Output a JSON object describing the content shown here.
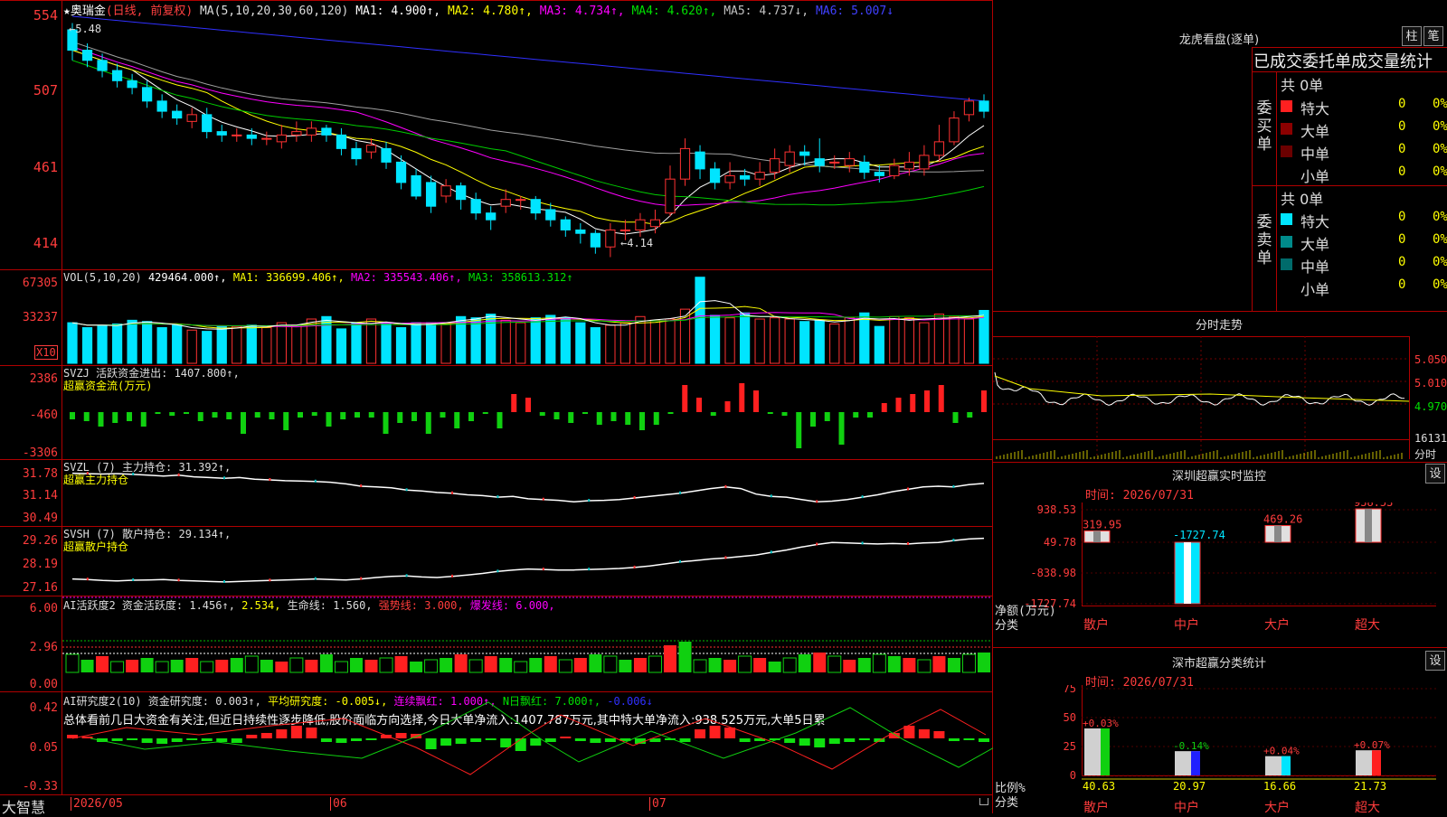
{
  "colors": {
    "up": "#ff3232",
    "down": "#00e5ff",
    "ma1": "#ffffff",
    "ma2": "#ffff00",
    "ma3": "#ff00ff",
    "ma4": "#00cc00",
    "ma5": "#a0a0a0",
    "ma6": "#3030ff",
    "frame": "#b00000",
    "label": "#ff3c3c"
  },
  "header": {
    "star": "★",
    "name": "奥瑞金",
    "period": "(日线, 前复权)",
    "ma_def": "MA(5,10,20,30,60,120)",
    "ma1": "MA1: 4.900↑,",
    "ma2": "MA2: 4.780↑,",
    "ma3": "MA3: 4.734↑,",
    "ma4": "MA4: 4.620↑,",
    "ma5": "MA5: 4.737↓,",
    "ma6": "MA6: 5.007↓"
  },
  "price_axis": [
    "554",
    "507",
    "461",
    "414"
  ],
  "annotations": {
    "high": "←5.48",
    "low": "←4.14"
  },
  "vol": {
    "title": "VOL(5,10,20)",
    "value": "429464.000↑,",
    "ma1": "MA1: 336699.406↑,",
    "ma2": "MA2: 335543.406↑,",
    "ma3": "MA3: 358613.312↑",
    "axis": [
      "67305",
      "33237"
    ],
    "unit": "X10"
  },
  "svzj": {
    "title": "SVZJ  活跃资金进出: 1407.800↑,",
    "sub": "超赢资金流(万元)",
    "axis": [
      "2386",
      "-460",
      "-3306"
    ]
  },
  "svzl": {
    "title": "SVZL (7) 主力持仓: 31.392↑,",
    "sub": "超赢主力持仓",
    "axis": [
      "31.78",
      "31.14",
      "30.49"
    ]
  },
  "svsh": {
    "title": "SVSH (7) 散户持仓: 29.134↑,",
    "sub": "超赢散户持仓",
    "axis": [
      "29.26",
      "28.19",
      "27.16"
    ]
  },
  "ai_act": {
    "t1": "AI活跃度2 资金活跃度: 1.456↑,",
    "t2": "2.534,",
    "t3": "生命线: 1.560,",
    "t4": "强势线: 3.000,",
    "t5": "爆发线: 6.000,",
    "axis": [
      "6.00",
      "2.96",
      "0.00"
    ]
  },
  "ai_res": {
    "t1": "AI研究度2(10) 资金研究度: 0.003↑,",
    "t2": "平均研究度: -0.005↓,",
    "t3": "连续飘红: 1.000↑,",
    "t4": "N日飘红: 7.000↑,",
    "t5": "-0.006↓",
    "summary": "总体看前几日大资金有关注,但近日持续性逐步降低,股价面临方向选择,今日大单净流入:1407.787万元,其中特大单净流入:938.525万元,大单5日累",
    "axis": [
      "0.42",
      "0.05",
      "-0.33"
    ]
  },
  "date_axis": {
    "brand": "大智慧",
    "d1": "2026/05",
    "d2": "06",
    "d3": "07"
  },
  "longhu": {
    "title": "龙虎看盘(逐单)",
    "btn1": "柱",
    "btn2": "笔",
    "tabs": "已成交委托单成交量统计",
    "buy": {
      "side": "委买单",
      "total": "共 0单",
      "rows": [
        {
          "name": "特大",
          "v": "0",
          "p": "0%"
        },
        {
          "name": "大单",
          "v": "0",
          "p": "0%"
        },
        {
          "name": "中单",
          "v": "0",
          "p": "0%"
        },
        {
          "name": "小单",
          "v": "0",
          "p": "0%"
        }
      ]
    },
    "sell": {
      "side": "委卖单",
      "total": "共 0单",
      "rows": [
        {
          "name": "特大",
          "v": "0",
          "p": "0%"
        },
        {
          "name": "大单",
          "v": "0",
          "p": "0%"
        },
        {
          "name": "中单",
          "v": "0",
          "p": "0%"
        },
        {
          "name": "小单",
          "v": "0",
          "p": "0%"
        }
      ]
    }
  },
  "intraday": {
    "title": "分时走势",
    "axis": [
      "5.050",
      "5.010",
      "4.970",
      "16131"
    ],
    "unit": "分时"
  },
  "sz_monitor": {
    "title": "深圳超赢实时监控",
    "btn": "设",
    "time": "时间: 2026/07/31",
    "axis": [
      "938.53",
      "49.78",
      "-838.98",
      "-1727.74"
    ],
    "ylabel": "净额(万元)",
    "xlabel": "分类",
    "bars": [
      {
        "cat": "散户",
        "val": "319.95"
      },
      {
        "cat": "中户",
        "val": "-1727.74"
      },
      {
        "cat": "大户",
        "val": "469.26"
      },
      {
        "cat": "超大",
        "val": "938.53"
      }
    ]
  },
  "sz_class": {
    "title": "深市超赢分类统计",
    "btn": "设",
    "time": "时间: 2026/07/31",
    "axis": [
      "75",
      "50",
      "25",
      "0"
    ],
    "ylabel": "比例%",
    "xlabel": "分类",
    "bars": [
      {
        "cat": "散户",
        "val": "40.63",
        "chg": "+0.03%"
      },
      {
        "cat": "中户",
        "val": "20.97",
        "chg": "-0.14%"
      },
      {
        "cat": "大户",
        "val": "16.66",
        "chg": "+0.04%"
      },
      {
        "cat": "超大",
        "val": "21.73",
        "chg": "+0.07%"
      }
    ]
  },
  "chart_data": {
    "type": "candlestick",
    "ylim": [
      414,
      554
    ],
    "candles": [
      [
        5.48,
        5.36,
        5.52,
        5.3
      ],
      [
        5.36,
        5.3,
        5.4,
        5.26
      ],
      [
        5.3,
        5.24,
        5.34,
        5.2
      ],
      [
        5.24,
        5.18,
        5.28,
        5.14
      ],
      [
        5.18,
        5.14,
        5.22,
        5.1
      ],
      [
        5.14,
        5.06,
        5.18,
        5.02
      ],
      [
        5.06,
        5.0,
        5.1,
        4.96
      ],
      [
        5.0,
        4.96,
        5.04,
        4.92
      ],
      [
        4.94,
        4.98,
        5.02,
        4.9
      ],
      [
        4.98,
        4.88,
        5.02,
        4.84
      ],
      [
        4.88,
        4.86,
        4.92,
        4.82
      ],
      [
        4.86,
        4.86,
        4.9,
        4.82
      ],
      [
        4.86,
        4.84,
        4.9,
        4.8
      ],
      [
        4.84,
        4.84,
        4.88,
        4.8
      ],
      [
        4.82,
        4.86,
        4.92,
        4.78
      ],
      [
        4.86,
        4.88,
        4.94,
        4.82
      ],
      [
        4.86,
        4.9,
        4.94,
        4.82
      ],
      [
        4.9,
        4.86,
        4.92,
        4.82
      ],
      [
        4.86,
        4.78,
        4.9,
        4.74
      ],
      [
        4.78,
        4.72,
        4.82,
        4.68
      ],
      [
        4.76,
        4.8,
        4.84,
        4.72
      ],
      [
        4.78,
        4.7,
        4.82,
        4.66
      ],
      [
        4.7,
        4.58,
        4.74,
        4.54
      ],
      [
        4.62,
        4.5,
        4.66,
        4.48
      ],
      [
        4.58,
        4.44,
        4.62,
        4.4
      ],
      [
        4.5,
        4.56,
        4.6,
        4.46
      ],
      [
        4.56,
        4.48,
        4.58,
        4.42
      ],
      [
        4.48,
        4.4,
        4.52,
        4.36
      ],
      [
        4.4,
        4.36,
        4.44,
        4.3
      ],
      [
        4.44,
        4.48,
        4.54,
        4.4
      ],
      [
        4.48,
        4.48,
        4.5,
        4.42
      ],
      [
        4.48,
        4.4,
        4.5,
        4.36
      ],
      [
        4.42,
        4.36,
        4.46,
        4.32
      ],
      [
        4.36,
        4.3,
        4.38,
        4.26
      ],
      [
        4.3,
        4.28,
        4.34,
        4.22
      ],
      [
        4.28,
        4.2,
        4.3,
        4.16
      ],
      [
        4.2,
        4.3,
        4.34,
        4.14
      ],
      [
        4.3,
        4.3,
        4.36,
        4.24
      ],
      [
        4.3,
        4.36,
        4.4,
        4.26
      ],
      [
        4.32,
        4.36,
        4.42,
        4.28
      ],
      [
        4.4,
        4.6,
        4.68,
        4.38
      ],
      [
        4.6,
        4.78,
        4.84,
        4.56
      ],
      [
        4.76,
        4.66,
        4.8,
        4.6
      ],
      [
        4.66,
        4.58,
        4.7,
        4.54
      ],
      [
        4.58,
        4.62,
        4.7,
        4.54
      ],
      [
        4.62,
        4.6,
        4.66,
        4.56
      ],
      [
        4.6,
        4.64,
        4.7,
        4.56
      ],
      [
        4.64,
        4.72,
        4.78,
        4.6
      ],
      [
        4.68,
        4.76,
        4.8,
        4.64
      ],
      [
        4.76,
        4.74,
        4.8,
        4.68
      ],
      [
        4.72,
        4.68,
        4.84,
        4.64
      ],
      [
        4.7,
        4.7,
        4.74,
        4.66
      ],
      [
        4.68,
        4.72,
        4.76,
        4.64
      ],
      [
        4.7,
        4.64,
        4.74,
        4.6
      ],
      [
        4.64,
        4.62,
        4.68,
        4.58
      ],
      [
        4.62,
        4.68,
        4.72,
        4.6
      ],
      [
        4.66,
        4.7,
        4.76,
        4.62
      ],
      [
        4.66,
        4.74,
        4.8,
        4.62
      ],
      [
        4.74,
        4.82,
        4.92,
        4.7
      ],
      [
        4.82,
        4.96,
        5.0,
        4.8
      ],
      [
        4.98,
        5.06,
        5.08,
        4.94
      ],
      [
        5.06,
        5.0,
        5.1,
        4.96
      ]
    ],
    "volume": [
      33,
      29,
      31,
      32,
      35,
      34,
      29,
      31,
      27,
      26,
      30,
      30,
      31,
      29,
      33,
      31,
      36,
      38,
      28,
      33,
      36,
      32,
      29,
      33,
      33,
      33,
      38,
      37,
      40,
      35,
      33,
      37,
      39,
      37,
      33,
      29,
      31,
      33,
      38,
      35,
      36,
      44,
      70,
      39,
      37,
      41,
      36,
      37,
      36,
      34,
      35,
      32,
      37,
      41,
      30,
      38,
      37,
      33,
      40,
      38,
      36,
      43
    ],
    "svzj": [
      -400,
      -500,
      -800,
      -600,
      -500,
      -800,
      -100,
      -200,
      -100,
      -500,
      -300,
      -400,
      -1200,
      -300,
      -400,
      -1000,
      -300,
      -200,
      -800,
      -400,
      -300,
      -300,
      -1200,
      -600,
      -500,
      -1200,
      -300,
      -900,
      -500,
      -100,
      -900,
      1000,
      800,
      -200,
      -400,
      -600,
      -100,
      -700,
      -500,
      -700,
      -1000,
      -700,
      -100,
      1500,
      800,
      -200,
      600,
      1600,
      1200,
      -100,
      -200,
      -2000,
      -800,
      -500,
      -1800,
      -300,
      -300,
      500,
      800,
      1000,
      1200,
      1500,
      -600,
      -300,
      1200
    ],
    "svzl": [
      31.65,
      31.64,
      31.63,
      31.64,
      31.62,
      31.6,
      31.58,
      31.6,
      31.56,
      31.54,
      31.52,
      31.54,
      31.5,
      31.48,
      31.46,
      31.45,
      31.44,
      31.42,
      31.38,
      31.32,
      31.3,
      31.28,
      31.22,
      31.2,
      31.16,
      31.14,
      31.1,
      31.08,
      31.04,
      31.06,
      31.0,
      30.98,
      30.96,
      30.92,
      30.95,
      30.96,
      30.98,
      31.02,
      31.06,
      31.1,
      31.14,
      31.2,
      31.26,
      31.3,
      31.26,
      31.12,
      31.06,
      31.04,
      30.98,
      30.92,
      30.94,
      30.98,
      31.04,
      31.1,
      31.18,
      31.24,
      31.3,
      31.32,
      31.3,
      31.36,
      31.39
    ],
    "svsh": [
      27.5,
      27.48,
      27.44,
      27.42,
      27.45,
      27.46,
      27.48,
      27.44,
      27.42,
      27.4,
      27.38,
      27.4,
      27.42,
      27.44,
      27.46,
      27.48,
      27.5,
      27.48,
      27.46,
      27.5,
      27.56,
      27.6,
      27.62,
      27.58,
      27.56,
      27.6,
      27.66,
      27.72,
      27.8,
      27.86,
      27.9,
      27.88,
      27.86,
      27.86,
      27.88,
      27.9,
      27.92,
      27.96,
      28.02,
      28.1,
      28.18,
      28.24,
      28.3,
      28.34,
      28.4,
      28.46,
      28.56,
      28.66,
      28.78,
      28.88,
      28.96,
      28.94,
      28.92,
      28.9,
      28.92,
      28.9,
      28.94,
      28.96,
      29.04,
      29.1,
      29.13
    ]
  }
}
